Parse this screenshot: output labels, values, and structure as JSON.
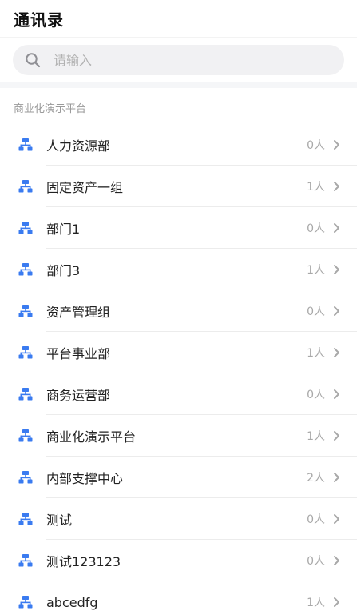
{
  "header": {
    "title": "通讯录"
  },
  "search": {
    "placeholder": "请输入"
  },
  "section": {
    "title": "商业化演示平台"
  },
  "colors": {
    "accent": "#3a7bf0",
    "muted": "#a8a8a8"
  },
  "icons": {
    "search": "search-icon",
    "department": "org-chart-icon",
    "chevron": "chevron-right-icon"
  },
  "departments": [
    {
      "name": "人力资源部",
      "count": "0人"
    },
    {
      "name": "固定资产一组",
      "count": "1人"
    },
    {
      "name": "部门1",
      "count": "0人"
    },
    {
      "name": "部门3",
      "count": "1人"
    },
    {
      "name": "资产管理组",
      "count": "0人"
    },
    {
      "name": "平台事业部",
      "count": "1人"
    },
    {
      "name": "商务运营部",
      "count": "0人"
    },
    {
      "name": "商业化演示平台",
      "count": "1人"
    },
    {
      "name": "内部支撑中心",
      "count": "2人"
    },
    {
      "name": "测试",
      "count": "0人"
    },
    {
      "name": "测试123123",
      "count": "0人"
    },
    {
      "name": "abcedfg",
      "count": "1人"
    }
  ]
}
